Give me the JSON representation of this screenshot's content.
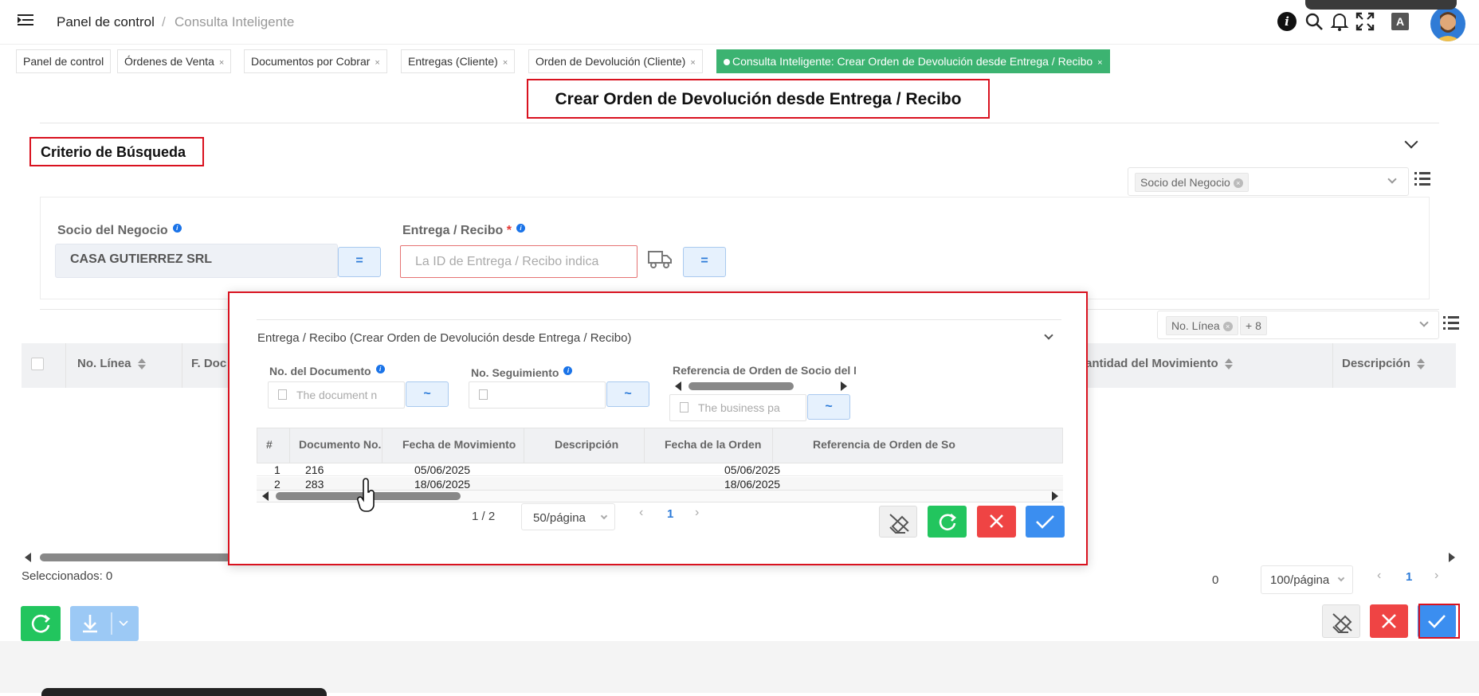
{
  "header": {
    "breadcrumb_home": "Panel de control",
    "breadcrumb_sep": "/",
    "breadcrumb_current": "Consulta Inteligente"
  },
  "tabs": [
    {
      "label": "Panel de control"
    },
    {
      "label": "Órdenes de Venta",
      "close": "×"
    },
    {
      "label": "Documentos por Cobrar",
      "close": "×"
    },
    {
      "label": "Entregas (Cliente)",
      "close": "×"
    },
    {
      "label": "Orden de Devolución (Cliente)",
      "close": "×"
    },
    {
      "label": "Consulta Inteligente: Crear Orden de Devolución desde Entrega / Recibo",
      "close": "×"
    }
  ],
  "page_title": "Crear Orden de Devolución desde Entrega / Recibo",
  "criteria": {
    "title": "Criterio de Búsqueda",
    "filter_chip": "Socio del Negocio",
    "bp_label": "Socio del Negocio",
    "bp_value": "CASA GUTIERREZ SRL",
    "bp_eq": "=",
    "delivery_label": "Entrega / Recibo",
    "delivery_required": "*",
    "delivery_placeholder": "La ID de Entrega / Recibo indica",
    "delivery_eq": "="
  },
  "grid": {
    "column_chip": "No. Línea",
    "column_more": "+ 8",
    "columns": [
      "No. Línea",
      "F. Doc",
      "antidad del Movimiento",
      "Descripción"
    ],
    "selected_label": "Seleccionados: 0",
    "total": "0",
    "page_size": "100/página",
    "page": "1"
  },
  "modal": {
    "title": "Entrega / Recibo (Crear Orden de Devolución desde Entrega / Recibo)",
    "filters": [
      {
        "label": "No. del Documento",
        "placeholder": "The document n",
        "op": "~"
      },
      {
        "label": "No. Seguimiento",
        "placeholder": "",
        "op": "~"
      },
      {
        "label": "Referencia de Orden de Socio del N",
        "placeholder": "The business pa",
        "op": "~"
      }
    ],
    "columns": [
      "#",
      "Documento No.",
      "Fecha de Movimiento",
      "Descripción",
      "Fecha de la Orden",
      "Referencia de Orden de So"
    ],
    "rows": [
      {
        "n": "1",
        "doc": "216",
        "fmov": "05/06/2025",
        "desc": "",
        "ford": "05/06/2025",
        "ref": ""
      },
      {
        "n": "2",
        "doc": "283",
        "fmov": "18/06/2025",
        "desc": "",
        "ford": "18/06/2025",
        "ref": ""
      }
    ],
    "count": "1 / 2",
    "page_size": "50/página",
    "page": "1"
  },
  "colors": {
    "active_tab": "#3cb371",
    "highlight": "#d9121f",
    "primary": "#3b8ef0",
    "success": "#22c55e",
    "danger": "#ef4444"
  }
}
